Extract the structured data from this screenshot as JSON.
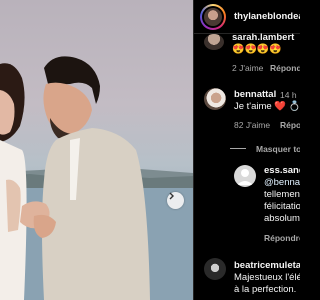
{
  "header": {
    "username": "thylaneblondeau"
  },
  "comments": [
    {
      "username": "sarah.lambert",
      "text": "😍😍😍😍",
      "likes": "2 J'aime",
      "reply": "Répondre"
    },
    {
      "username": "bennattal",
      "time": "14 h",
      "text": "Je t'aime ❤️ 💍",
      "likes": "82 J'aime",
      "reply": "Répondre"
    }
  ],
  "hide_replies": "Masquer toutes les réponses",
  "reply_comment": {
    "username": "ess.sandra",
    "lines": [
      "@bennattal",
      "tellement",
      "félicitation",
      "absolument"
    ],
    "reply": "Répondre"
  },
  "last_comment": {
    "username": "beatricemuletar",
    "lines": [
      "Majestueux l'élé",
      "à la perfection."
    ]
  }
}
